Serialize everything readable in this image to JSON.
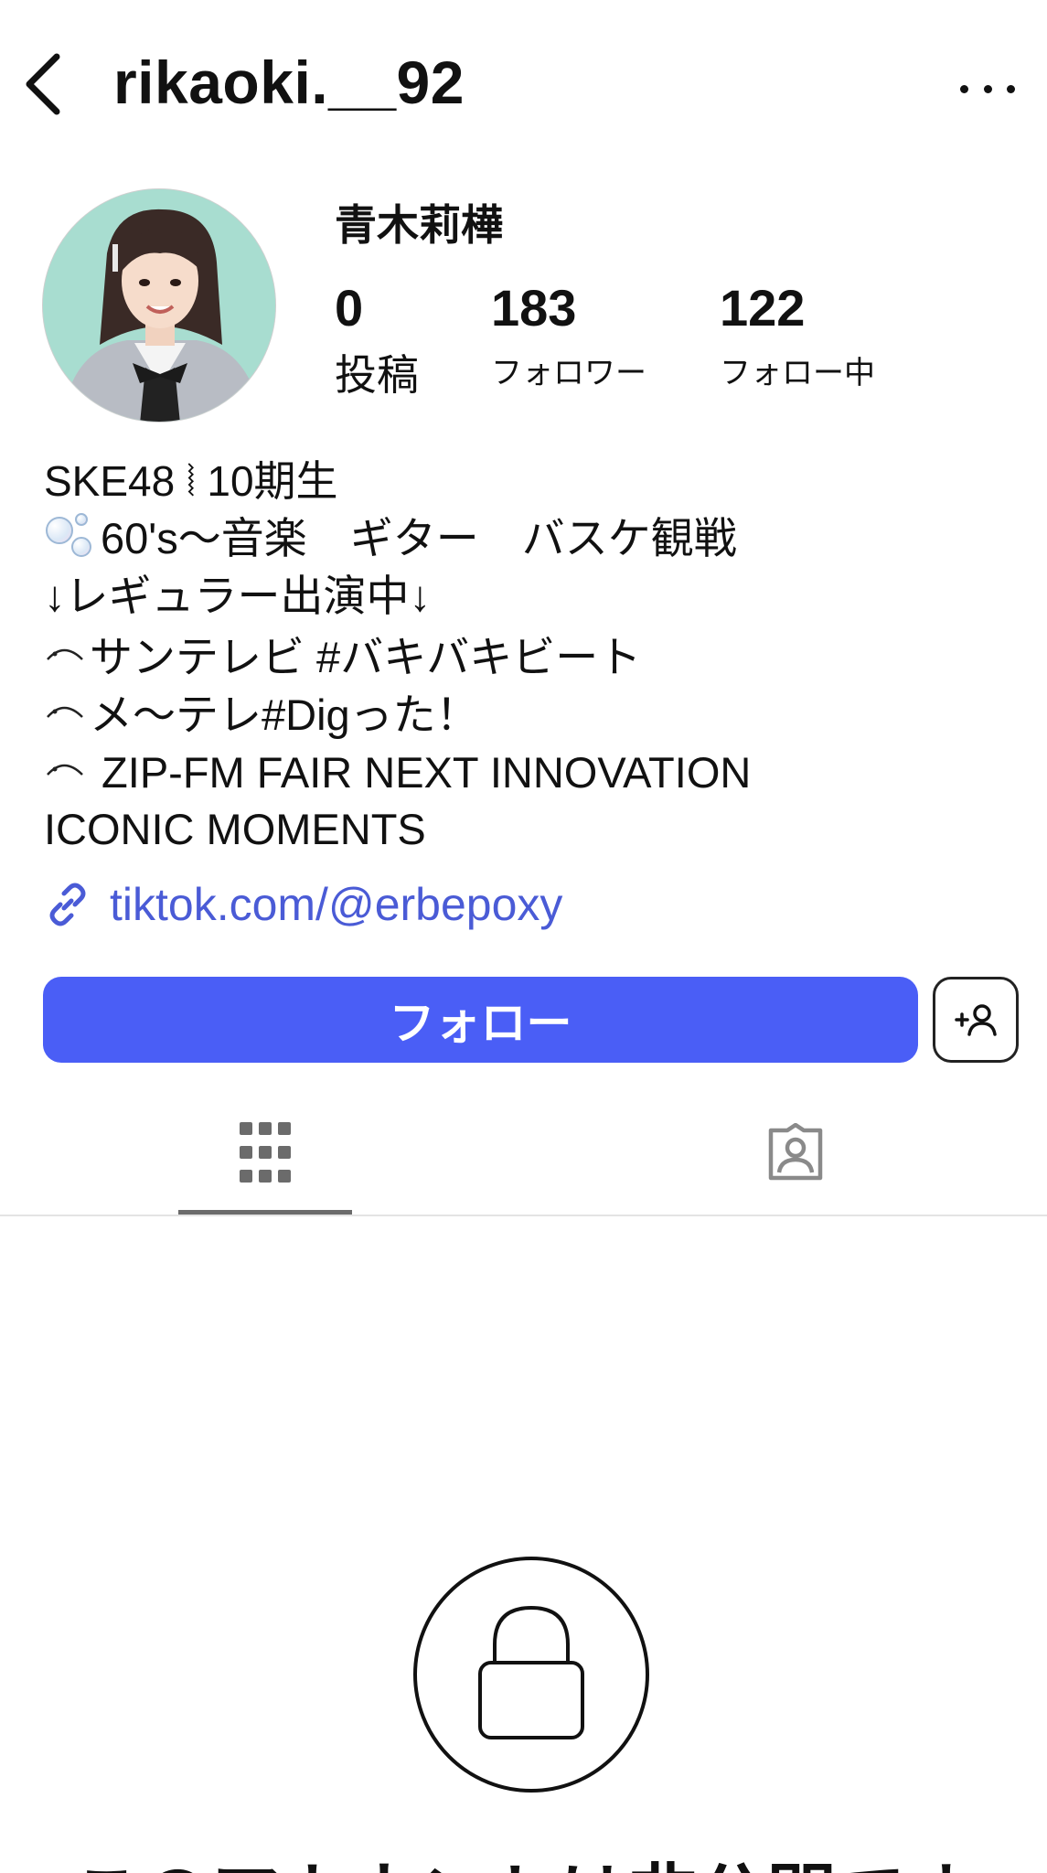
{
  "header": {
    "username": "rikaoki.__92",
    "back_icon": "chevron-left-icon",
    "more_icon": "ellipsis-icon"
  },
  "profile": {
    "display_name": "青木莉樺",
    "stats": {
      "posts": {
        "count": "0",
        "label": "投稿"
      },
      "followers": {
        "count": "183",
        "label": "フォロワー"
      },
      "following": {
        "count": "122",
        "label": "フォロー中"
      }
    }
  },
  "bio": {
    "line1": "SKE48 ⦚  10期生",
    "line2": "60's〜音楽　ギター　バスケ観戦",
    "line3": "↓レギュラー出演中↓",
    "line4": "サンテレビ #バキバキビート",
    "line5": "メ〜テレ#Digった！",
    "line6": " ZIP-FM FAIR NEXT INNOVATION",
    "line7": "ICONIC MOMENTS"
  },
  "link": {
    "text": "tiktok.com/@erbepoxy",
    "icon": "link-icon"
  },
  "actions": {
    "follow_label": "フォロー",
    "add_user_icon": "add-user-icon"
  },
  "tabs": [
    {
      "icon": "grid-icon",
      "active": true
    },
    {
      "icon": "tagged-person-icon",
      "active": false
    }
  ],
  "private": {
    "message": "このアカウントは非公開です",
    "icon": "lock-icon"
  },
  "colors": {
    "accent": "#4a5ef6",
    "link": "#4a5bd6",
    "text": "#111111",
    "tab_icon": "#6b6b6b"
  }
}
